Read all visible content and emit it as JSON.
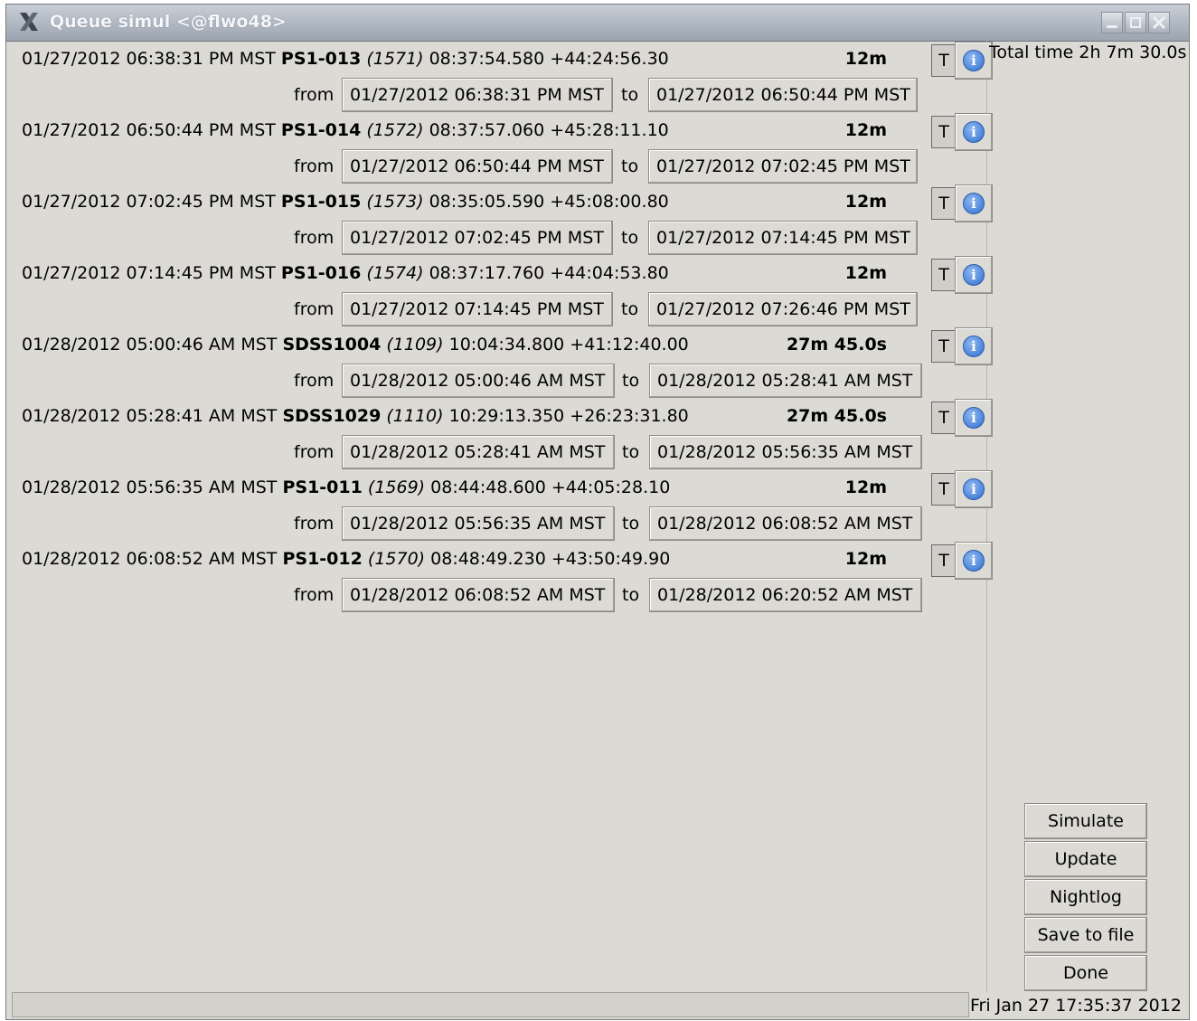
{
  "window": {
    "title": "Queue simul <@flwo48>"
  },
  "entries": [
    {
      "start": "01/27/2012 06:38:31 PM MST",
      "name": "PS1-013",
      "id": "(1571)",
      "coords": "08:37:54.580 +44:24:56.30",
      "duration": "12m",
      "from": "01/27/2012 06:38:31 PM MST",
      "to": "01/27/2012 06:50:44 PM MST"
    },
    {
      "start": "01/27/2012 06:50:44 PM MST",
      "name": "PS1-014",
      "id": "(1572)",
      "coords": "08:37:57.060 +45:28:11.10",
      "duration": "12m",
      "from": "01/27/2012 06:50:44 PM MST",
      "to": "01/27/2012 07:02:45 PM MST"
    },
    {
      "start": "01/27/2012 07:02:45 PM MST",
      "name": "PS1-015",
      "id": "(1573)",
      "coords": "08:35:05.590 +45:08:00.80",
      "duration": "12m",
      "from": "01/27/2012 07:02:45 PM MST",
      "to": "01/27/2012 07:14:45 PM MST"
    },
    {
      "start": "01/27/2012 07:14:45 PM MST",
      "name": "PS1-016",
      "id": "(1574)",
      "coords": "08:37:17.760 +44:04:53.80",
      "duration": "12m",
      "from": "01/27/2012 07:14:45 PM MST",
      "to": "01/27/2012 07:26:46 PM MST"
    },
    {
      "start": "01/28/2012 05:00:46 AM MST",
      "name": "SDSS1004",
      "id": "(1109)",
      "coords": "10:04:34.800 +41:12:40.00",
      "duration": "27m 45.0s",
      "from": "01/28/2012 05:00:46 AM MST",
      "to": "01/28/2012 05:28:41 AM MST"
    },
    {
      "start": "01/28/2012 05:28:41 AM MST",
      "name": "SDSS1029",
      "id": "(1110)",
      "coords": "10:29:13.350 +26:23:31.80",
      "duration": "27m 45.0s",
      "from": "01/28/2012 05:28:41 AM MST",
      "to": "01/28/2012 05:56:35 AM MST"
    },
    {
      "start": "01/28/2012 05:56:35 AM MST",
      "name": "PS1-011",
      "id": "(1569)",
      "coords": "08:44:48.600 +44:05:28.10",
      "duration": "12m",
      "from": "01/28/2012 05:56:35 AM MST",
      "to": "01/28/2012 06:08:52 AM MST"
    },
    {
      "start": "01/28/2012 06:08:52 AM MST",
      "name": "PS1-012",
      "id": "(1570)",
      "coords": "08:48:49.230 +43:50:49.90",
      "duration": "12m",
      "from": "01/28/2012 06:08:52 AM MST",
      "to": "01/28/2012 06:20:52 AM MST"
    }
  ],
  "labels": {
    "from": "from",
    "to": "to",
    "t_button": "T",
    "info_glyph": "i"
  },
  "side": {
    "total_time": "Total time 2h 7m 30.0s",
    "buttons": [
      "Simulate",
      "Update",
      "Nightlog",
      "Save to file",
      "Done"
    ]
  },
  "status": {
    "clock": "Fri Jan 27 17:35:37 2012"
  },
  "colors": {
    "window_bg": "#dcdad5",
    "info_blue": "#2f6fd0",
    "titlebar": "#9aa3b0"
  }
}
